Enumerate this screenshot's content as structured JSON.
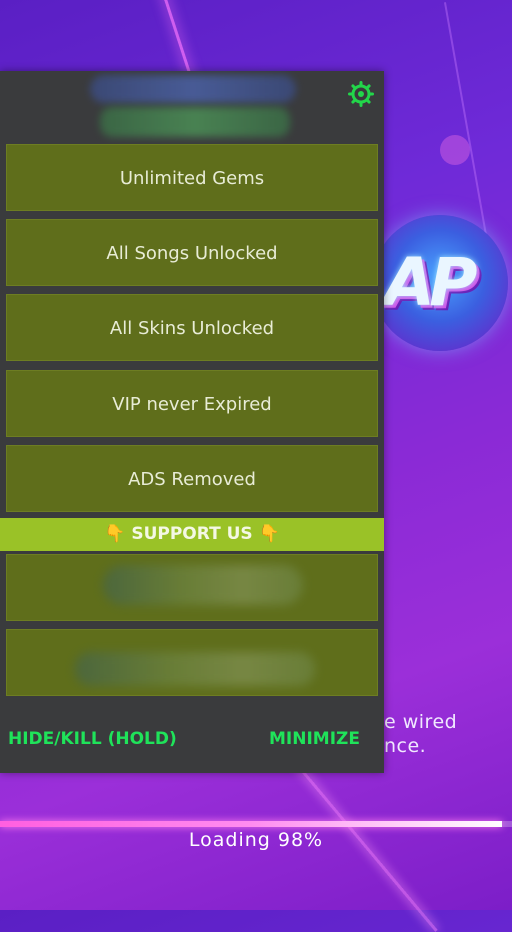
{
  "background": {
    "loading_text": "Loading   98%",
    "loading_progress": 0.98,
    "partial_text_line1": "e wired",
    "partial_text_line2": "nce.",
    "logo_text": "AP"
  },
  "menu": {
    "settings_icon": "gear-icon",
    "buttons": [
      {
        "label": "Unlimited Gems"
      },
      {
        "label": "All Songs Unlocked"
      },
      {
        "label": "All Skins Unlocked"
      },
      {
        "label": "VIP never Expired"
      },
      {
        "label": "ADS Removed"
      }
    ],
    "support_label": "👇 SUPPORT US 👇",
    "footer": {
      "hide_label": "HIDE/KILL (HOLD)",
      "minimize_label": "MINIMIZE"
    }
  },
  "colors": {
    "accent_green": "#1fe35a",
    "button_olive": "#5f6e1b",
    "support_lime": "#9ac227",
    "panel_bg": "#3a3b3d"
  }
}
